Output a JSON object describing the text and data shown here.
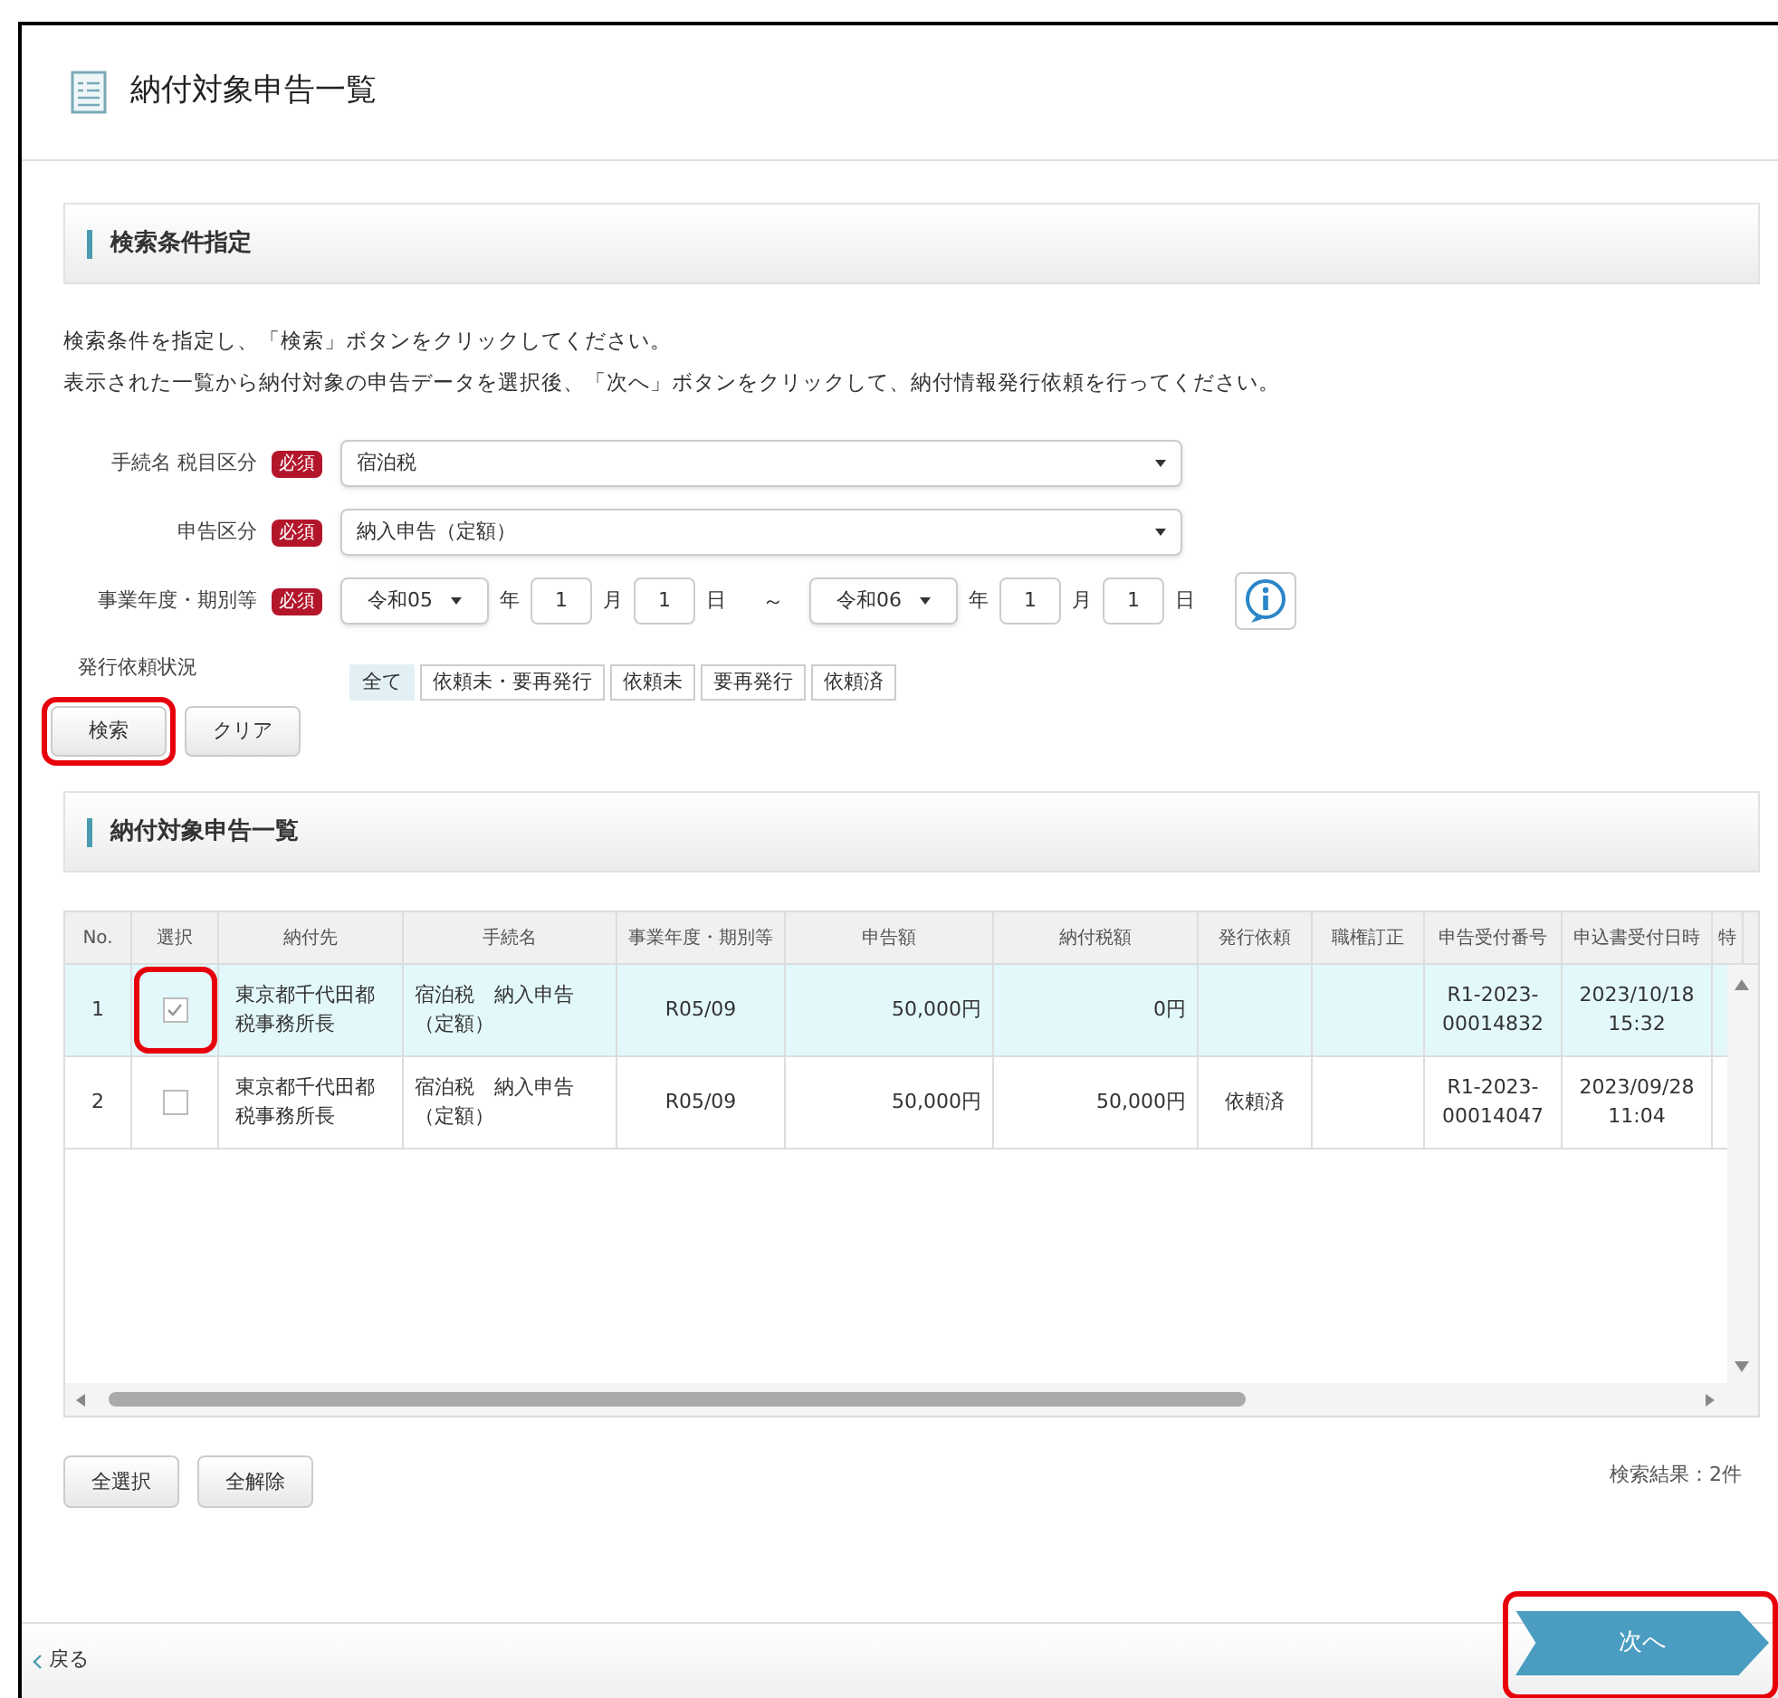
{
  "page": {
    "title": "納付対象申告一覧"
  },
  "search_section": {
    "heading": "検索条件指定",
    "instructions": [
      "検索条件を指定し、「検索」ボタンをクリックしてください。",
      "表示された一覧から納付対象の申告データを選択後、「次へ」ボタンをクリックして、納付情報発行依頼を行ってください。"
    ],
    "fields": [
      {
        "kind": "select",
        "label": "手続名 税目区分",
        "required": "必須",
        "value": "宿泊税"
      },
      {
        "kind": "select",
        "label": "申告区分",
        "required": "必須",
        "value": "納入申告（定額）"
      },
      {
        "kind": "date_range",
        "label": "事業年度・期別等",
        "required": "必須",
        "from": {
          "era": "令和05",
          "year_unit": "年",
          "month": "1",
          "month_unit": "月",
          "day": "1",
          "day_unit": "日"
        },
        "separator": "～",
        "to": {
          "era": "令和06",
          "year_unit": "年",
          "month": "1",
          "month_unit": "月",
          "day": "1",
          "day_unit": "日"
        }
      }
    ],
    "status_filter": {
      "label": "発行依頼状況",
      "options": [
        {
          "label": "全て",
          "selected": true
        },
        {
          "label": "依頼未・要再発行",
          "selected": false
        },
        {
          "label": "依頼未",
          "selected": false
        },
        {
          "label": "要再発行",
          "selected": false
        },
        {
          "label": "依頼済",
          "selected": false
        }
      ]
    },
    "buttons": [
      {
        "label": "検索",
        "highlighted": true
      },
      {
        "label": "クリア",
        "highlighted": false
      }
    ]
  },
  "list_section": {
    "heading": "納付対象申告一覧",
    "table": {
      "columns": [
        "No.",
        "選択",
        "納付先",
        "手続名",
        "事業年度・期別等",
        "申告額",
        "納付税額",
        "発行依頼",
        "職権訂正",
        "申告受付番号",
        "申込書受付日時",
        "特"
      ],
      "rows": [
        {
          "selected": true,
          "checked": true,
          "highlighted": true,
          "no": "1",
          "payee": "東京都千代田都税事務所長",
          "procedure": "宿泊税　納入申告（定額）",
          "period": "R05/09",
          "declared": "50,000円",
          "tax": "0円",
          "receipt": "R1-2023-00014832",
          "received": "2023/10/18 15:32"
        },
        {
          "selected": false,
          "checked": false,
          "highlighted": false,
          "no": "2",
          "payee": "東京都千代田都税事務所長",
          "procedure": "宿泊税　納入申告（定額）",
          "period": "R05/09",
          "declared": "50,000円",
          "tax": "50,000円",
          "request": "依頼済",
          "receipt": "R1-2023-00014047",
          "received": "2023/09/28 11:04"
        }
      ]
    },
    "buttons": [
      "全選択",
      "全解除"
    ],
    "result_count": "検索結果：2件"
  },
  "bottom_bar": {
    "back": "戻る",
    "next": {
      "label": "次へ",
      "highlighted": true
    }
  }
}
